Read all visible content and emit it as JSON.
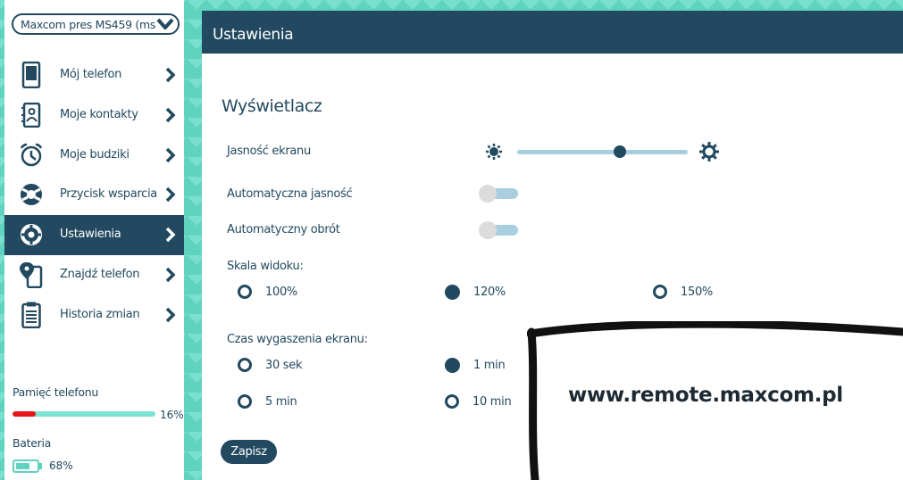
{
  "device_select": {
    "value": "Maxcom pres MS459 (ms"
  },
  "sidebar": {
    "items": [
      {
        "label": "Mój telefon",
        "icon": "phone-icon"
      },
      {
        "label": "Moje kontakty",
        "icon": "contacts-icon"
      },
      {
        "label": "Moje budziki",
        "icon": "alarm-clock-icon"
      },
      {
        "label": "Przycisk wsparcia",
        "icon": "lifebuoy-icon"
      },
      {
        "label": "Ustawienia",
        "icon": "gear-icon",
        "active": true
      },
      {
        "label": "Znajdź telefon",
        "icon": "location-phone-icon"
      },
      {
        "label": "Historia zmian",
        "icon": "clipboard-icon"
      }
    ]
  },
  "memory": {
    "label": "Pamięć telefonu",
    "percent_text": "16%",
    "fraction": 0.16
  },
  "battery": {
    "label": "Bateria",
    "percent_text": "68%",
    "fraction": 0.68
  },
  "header": {
    "title": "Ustawienia"
  },
  "display": {
    "title": "Wyświetlacz",
    "brightness": {
      "label": "Jasność ekranu",
      "fraction": 0.6
    },
    "auto_brightness": {
      "label": "Automatyczna jasność",
      "on": false
    },
    "auto_rotate": {
      "label": "Automatyczny obrót",
      "on": false
    },
    "scale": {
      "label": "Skala widoku:",
      "options": [
        "100%",
        "120%",
        "150%"
      ],
      "selected": "120%"
    },
    "timeout": {
      "label": "Czas wygaszenia ekranu:",
      "options": [
        "30 sek",
        "1 min",
        "5 min",
        "10 min"
      ],
      "selected": "1 min"
    },
    "save_label": "Zapisz"
  },
  "overlay": {
    "text": "www.remote.maxcom.pl"
  },
  "colors": {
    "primary": "#22495f",
    "accent": "#5fd3c0",
    "track": "#a9cee0",
    "memory_fill": "#e8141b"
  }
}
